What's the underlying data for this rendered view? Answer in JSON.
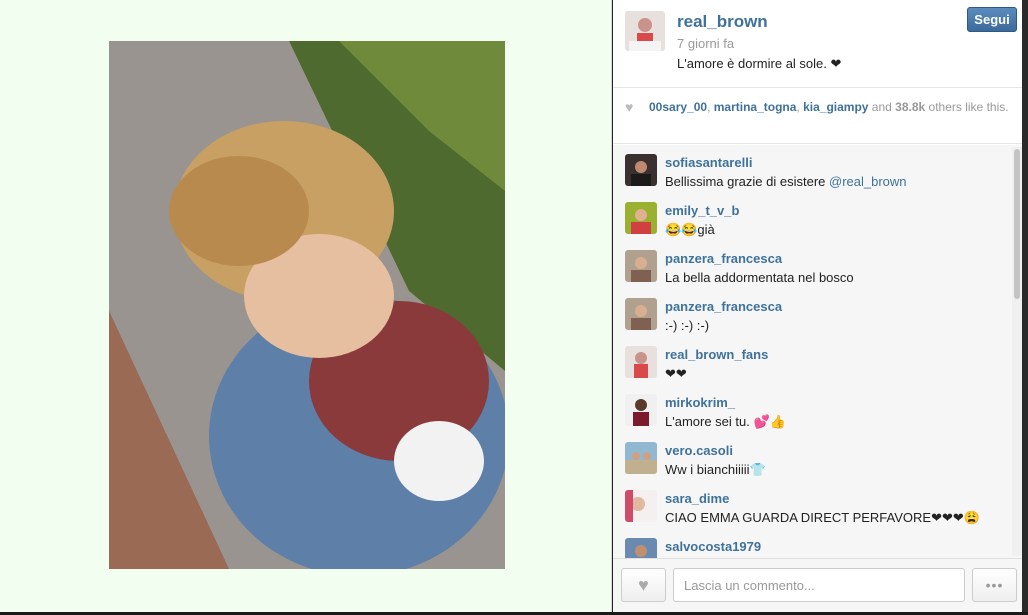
{
  "post": {
    "username": "real_brown",
    "time_ago": "7 giorni fa",
    "caption": "L'amore è dormire al sole. ❤",
    "follow_label": "Segui"
  },
  "likes": {
    "user1": "00sary_00",
    "sep1": ", ",
    "user2": "martina_togna",
    "sep2": ", ",
    "user3": "kia_giampy",
    "and": " and ",
    "count": "38.8k",
    "rest": " others like this."
  },
  "comments": [
    {
      "user": "sofiasantarelli",
      "text": "Bellissima grazie di esistere ",
      "mention": "@real_brown"
    },
    {
      "user": "emily_t_v_b",
      "text": "😂😂già"
    },
    {
      "user": "panzera_francesca",
      "text": "La bella addormentata nel bosco"
    },
    {
      "user": "panzera_francesca",
      "text": ":-) :-) :-)"
    },
    {
      "user": "real_brown_fans",
      "text": "❤❤"
    },
    {
      "user": "mirkokrim_",
      "text": "L'amore sei tu. 💕👍"
    },
    {
      "user": "vero.casoli",
      "text": "Ww i bianchiiiii👕"
    },
    {
      "user": "sara_dime",
      "text": "CIAO EMMA GUARDA DIRECT PERFAVORE❤❤❤😩"
    },
    {
      "user": "salvocosta1979",
      "text": ""
    }
  ],
  "footer": {
    "like_icon": "♥",
    "comment_placeholder": "Lascia un commento...",
    "more_label": "•••"
  },
  "icons": {
    "heart": "♥"
  },
  "colors": {
    "link": "#3f729b",
    "follow": "#4a7ab0",
    "page_bg": "#f2fff0"
  }
}
